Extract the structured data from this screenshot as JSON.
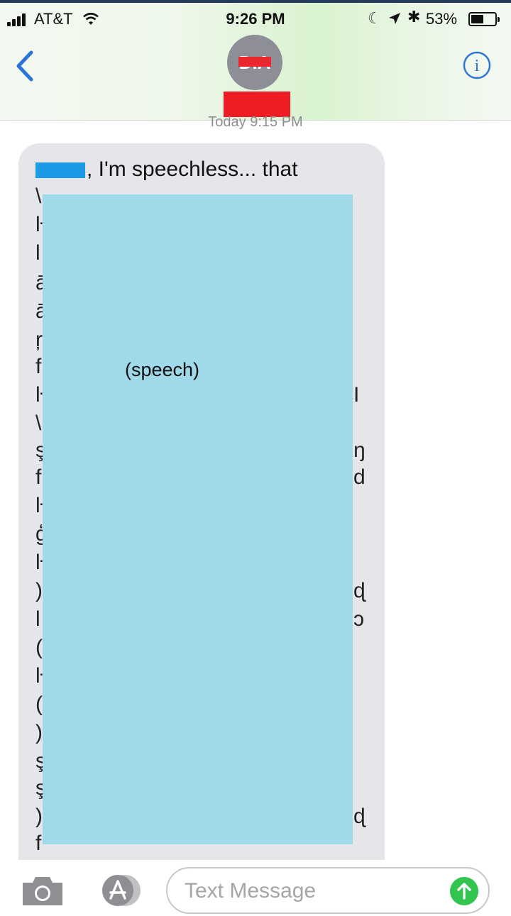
{
  "status_bar": {
    "carrier": "AT&T",
    "time": "9:26 PM",
    "battery_percent": "53%",
    "battery_level": 0.53,
    "icons": [
      "signal-icon",
      "wifi-icon",
      "moon-icon",
      "location-icon",
      "bluetooth-icon",
      "battery-icon"
    ]
  },
  "header": {
    "avatar_initials": "D.A",
    "icons": [
      "chevron-left-icon",
      "info-icon"
    ],
    "accent_color": "#2a73d8"
  },
  "thread": {
    "timestamp": "Today 9:15 PM",
    "message": {
      "first_line": ", I'm speechless... that",
      "overlay_label": "(speech)",
      "bubble_color": "#e5e5ea",
      "overlay_color": "#9fd9ea"
    }
  },
  "input_bar": {
    "placeholder": "Text Message",
    "icons": [
      "camera-icon",
      "app-store-icon",
      "send-arrow-icon"
    ],
    "send_color": "#31c54f"
  }
}
